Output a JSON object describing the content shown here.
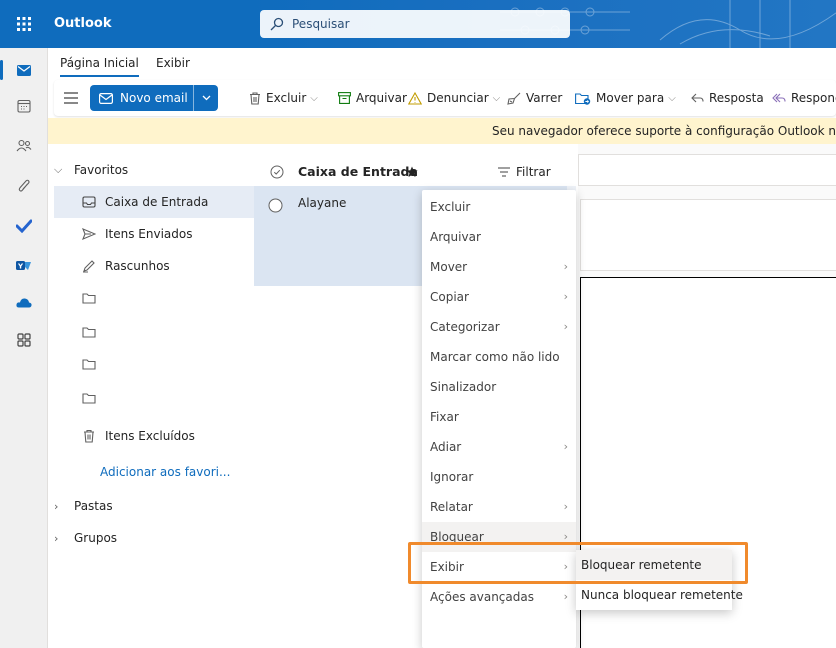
{
  "app": {
    "title": "Outlook"
  },
  "search": {
    "placeholder": "Pesquisar"
  },
  "ribbon": {
    "tabs": [
      {
        "label": "Página Inicial"
      },
      {
        "label": "Exibir"
      }
    ]
  },
  "toolbar": {
    "new_mail": "Novo email",
    "delete": "Excluir",
    "archive": "Arquivar",
    "report": "Denunciar",
    "sweep": "Varrer",
    "move_to": "Mover para",
    "reply": "Resposta",
    "reply_all": "Respond"
  },
  "notice": {
    "text": "Seu navegador oferece suporte à configuração Outlook na Web c"
  },
  "folders": {
    "favorites": "Favoritos",
    "items": [
      {
        "label": "Caixa de Entrada"
      },
      {
        "label": "Itens Enviados"
      },
      {
        "label": "Rascunhos"
      },
      {
        "label": ""
      },
      {
        "label": ""
      },
      {
        "label": ""
      },
      {
        "label": ""
      },
      {
        "label": "Itens Excluídos"
      }
    ],
    "add_favorite": "Adicionar aos favori...",
    "folders_group": "Pastas",
    "groups_group": "Grupos"
  },
  "message_list": {
    "title": "Caixa de Entrada",
    "filter": "Filtrar",
    "messages": [
      {
        "sender": "Alayane"
      }
    ]
  },
  "context_menu": {
    "items": [
      {
        "label": "Excluir"
      },
      {
        "label": "Arquivar"
      },
      {
        "label": "Mover"
      },
      {
        "label": "Copiar"
      },
      {
        "label": "Categorizar"
      },
      {
        "label": "Marcar como não lido"
      },
      {
        "label": "Sinalizador"
      },
      {
        "label": "Fixar"
      },
      {
        "label": "Adiar"
      },
      {
        "label": "Ignorar"
      },
      {
        "label": "Relatar"
      },
      {
        "label": "Bloquear"
      },
      {
        "label": "Exibir"
      },
      {
        "label": "Ações avançadas"
      }
    ]
  },
  "submenu": {
    "items": [
      {
        "label": "Bloquear remetente"
      },
      {
        "label": "Nunca bloquear remetente"
      }
    ]
  },
  "colors": {
    "accent": "#0f6cbd",
    "highlight": "#f08a2c",
    "notice_bg": "#fff4ce"
  }
}
